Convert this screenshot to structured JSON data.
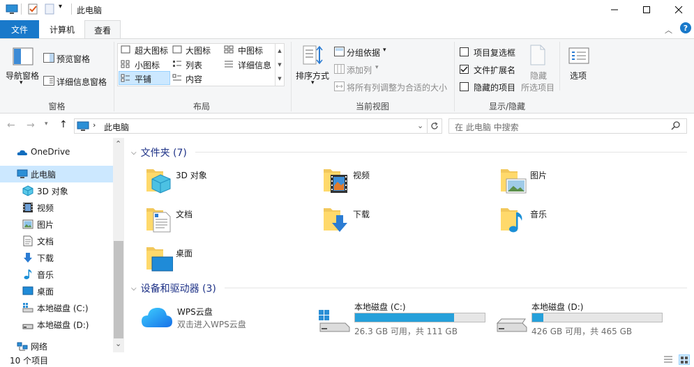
{
  "window": {
    "title": "此电脑"
  },
  "tabs": {
    "file": "文件",
    "computer": "计算机",
    "view": "查看"
  },
  "ribbon": {
    "panes": {
      "nav_pane": "导航窗格",
      "preview_pane": "预览窗格",
      "details_pane": "详细信息窗格",
      "label": "窗格"
    },
    "layout": {
      "extra_large": "超大图标",
      "large": "大图标",
      "medium": "中图标",
      "small": "小图标",
      "list": "列表",
      "details": "详细信息",
      "tiles": "平铺",
      "content": "内容",
      "label": "布局"
    },
    "current_view": {
      "sort_by": "排序方式",
      "group_by": "分组依据",
      "add_columns": "添加列",
      "fit_columns": "将所有列调整为合适的大小",
      "label": "当前视图"
    },
    "show_hide": {
      "item_checkboxes": "项目复选框",
      "file_extensions": "文件扩展名",
      "hidden_items": "隐藏的项目",
      "hide_selected": "隐藏",
      "hide_selected_2": "所选项目",
      "options": "选项",
      "label": "显示/隐藏",
      "item_checkboxes_checked": false,
      "file_extensions_checked": true,
      "hidden_items_checked": false
    }
  },
  "address": {
    "path": "此电脑",
    "search_placeholder": "在 此电脑 中搜索"
  },
  "nav": {
    "items": [
      {
        "label": "OneDrive",
        "icon": "onedrive-icon"
      },
      {
        "label": "此电脑",
        "icon": "pc-icon"
      },
      {
        "label": "3D 对象",
        "icon": "3d-objects-icon"
      },
      {
        "label": "视频",
        "icon": "videos-icon"
      },
      {
        "label": "图片",
        "icon": "pictures-icon"
      },
      {
        "label": "文档",
        "icon": "documents-icon"
      },
      {
        "label": "下载",
        "icon": "downloads-icon"
      },
      {
        "label": "音乐",
        "icon": "music-icon"
      },
      {
        "label": "桌面",
        "icon": "desktop-icon"
      },
      {
        "label": "本地磁盘 (C:)",
        "icon": "drive-icon"
      },
      {
        "label": "本地磁盘 (D:)",
        "icon": "drive-icon"
      },
      {
        "label": "网络",
        "icon": "network-icon"
      }
    ]
  },
  "folders": {
    "header": "文件夹 (7)",
    "items": [
      {
        "label": "3D 对象"
      },
      {
        "label": "视频"
      },
      {
        "label": "图片"
      },
      {
        "label": "文档"
      },
      {
        "label": "下载"
      },
      {
        "label": "音乐"
      },
      {
        "label": "桌面"
      }
    ]
  },
  "devices": {
    "header": "设备和驱动器 (3)",
    "wps": {
      "label": "WPS云盘",
      "sub": "双击进入WPS云盘"
    },
    "drive_c": {
      "label": "本地磁盘 (C:)",
      "sub": "26.3 GB 可用，共 111 GB",
      "used_fraction": 0.763
    },
    "drive_d": {
      "label": "本地磁盘 (D:)",
      "sub": "426 GB 可用，共 465 GB",
      "used_fraction": 0.084
    }
  },
  "status": {
    "count": "10 个项目"
  }
}
